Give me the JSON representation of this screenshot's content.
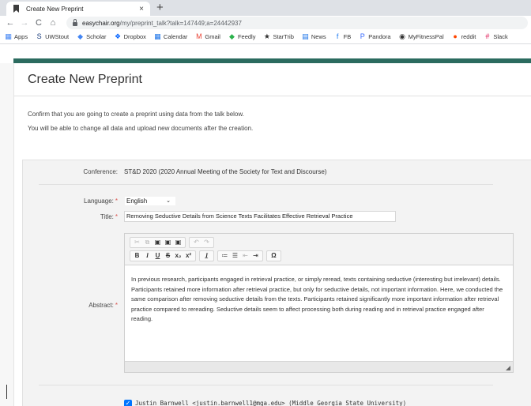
{
  "browser": {
    "tab_title": "Create New Preprint",
    "tab_close": "×",
    "new_tab": "+",
    "url_host": "easychair.org",
    "url_path": "/my/preprint_talk?talk=147449;a=24442937",
    "bookmarks": [
      {
        "label": "Apps",
        "icon": "▦",
        "color": "#4285f4"
      },
      {
        "label": "UWStout",
        "icon": "S",
        "color": "#1a3d7c"
      },
      {
        "label": "Scholar",
        "icon": "◆",
        "color": "#4285f4"
      },
      {
        "label": "Dropbox",
        "icon": "❖",
        "color": "#0061ff"
      },
      {
        "label": "Calendar",
        "icon": "▦",
        "color": "#1a73e8"
      },
      {
        "label": "Gmail",
        "icon": "M",
        "color": "#ea4335"
      },
      {
        "label": "Feedly",
        "icon": "◆",
        "color": "#2bb24c"
      },
      {
        "label": "StarTrib",
        "icon": "★",
        "color": "#333333"
      },
      {
        "label": "News",
        "icon": "▤",
        "color": "#1a73e8"
      },
      {
        "label": "FB",
        "icon": "f",
        "color": "#1877f2"
      },
      {
        "label": "Pandora",
        "icon": "P",
        "color": "#3668ff"
      },
      {
        "label": "MyFitnessPal",
        "icon": "◉",
        "color": "#333333"
      },
      {
        "label": "reddit",
        "icon": "●",
        "color": "#ff4500"
      },
      {
        "label": "Slack",
        "icon": "#",
        "color": "#e01e5a"
      }
    ]
  },
  "page": {
    "title": "Create New Preprint",
    "intro_line1": "Confirm that you are going to create a preprint using data from the talk below.",
    "intro_line2": "You will be able to change all data and upload new documents after the creation."
  },
  "form": {
    "conference_label": "Conference:",
    "conference_value": "ST&D 2020 (2020 Annual Meeting of the Society for Text and Discourse)",
    "language_label": "Language:",
    "language_value": "English",
    "title_label": "Title:",
    "title_value": "Removing Seductive Details from Science Texts Facilitates Effective Retrieval Practice",
    "abstract_label": "Abstract:",
    "abstract_value": "In previous research, participants engaged in retrieval practice, or simply reread, texts containing seductive (interesting but irrelevant) details. Participants retained more information after retrieval practice, but only for seductive details, not important information. Here, we conducted the same comparison after removing seductive details from the texts. Participants retained significantly more important information after retrieval practice compared to rereading. Seductive details seem to affect processing both during reading and in retrieval practice engaged after reading.",
    "required_mark": "*",
    "author": "Justin Barnwell <justin.barnwell1@mga.edu> (Middle Georgia State University)",
    "check_mark": "✓"
  },
  "colors": {
    "accent": "#2b6b5f",
    "required": "#d9534f",
    "checkbox": "#0075ff"
  }
}
